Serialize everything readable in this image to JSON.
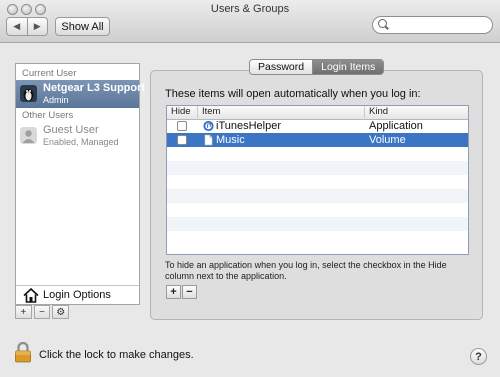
{
  "window": {
    "title": "Users & Groups"
  },
  "toolbar": {
    "back_icon": "chevron-left-icon",
    "forward_icon": "chevron-right-icon",
    "show_all_label": "Show All",
    "search_placeholder": ""
  },
  "sidebar": {
    "current_user_header": "Current User",
    "current_user": {
      "name": "Netgear L3 Support",
      "role": "Admin",
      "avatar_icon": "penguin-avatar-icon"
    },
    "other_users_header": "Other Users",
    "other_users": [
      {
        "name": "Guest User",
        "role": "Enabled, Managed",
        "avatar_icon": "person-silhouette-icon"
      }
    ],
    "login_options_label": "Login Options",
    "buttons": [
      {
        "label": "+",
        "icon": "add-icon"
      },
      {
        "label": "−",
        "icon": "remove-icon"
      },
      {
        "label": "⚙",
        "icon": "gear-icon"
      }
    ]
  },
  "main": {
    "tabs": [
      {
        "label": "Password",
        "selected": false
      },
      {
        "label": "Login Items",
        "selected": true
      }
    ],
    "intro_text": "These items will open automatically when you log in:",
    "columns": [
      "Hide",
      "Item",
      "Kind"
    ],
    "rows": [
      {
        "hide": false,
        "icon": "itunes-helper-icon",
        "item": "iTunesHelper",
        "kind": "Application",
        "selected": false
      },
      {
        "hide": false,
        "icon": "document-icon",
        "item": "Music",
        "kind": "Volume",
        "selected": true
      }
    ],
    "help_text": "To hide an application when you log in, select the checkbox in the Hide column next to the application.",
    "add_label": "+",
    "remove_label": "−"
  },
  "footer": {
    "lock_text": "Click the lock to make changes.",
    "help_label": "?"
  },
  "colors": {
    "selection": "#3b75c4",
    "sidebar_selection": "#5b7598"
  }
}
